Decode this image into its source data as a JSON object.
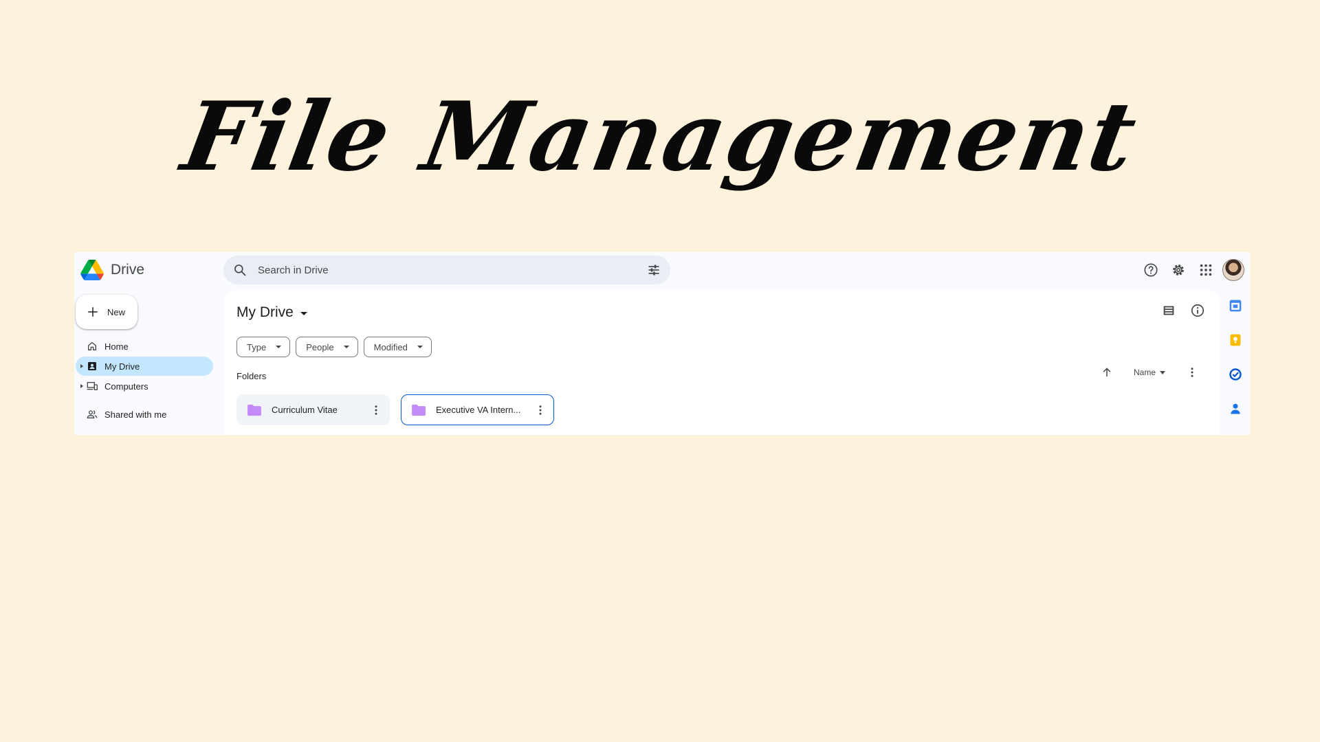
{
  "banner": {
    "title": "File Management"
  },
  "app": {
    "name": "Drive",
    "search_placeholder": "Search in Drive"
  },
  "sidebar": {
    "new_label": "New",
    "items": [
      {
        "label": "Home",
        "icon": "home-icon",
        "active": false
      },
      {
        "label": "My Drive",
        "icon": "my-drive-icon",
        "active": true
      },
      {
        "label": "Computers",
        "icon": "computers-icon",
        "active": false
      },
      {
        "label": "Shared with me",
        "icon": "shared-icon",
        "active": false
      }
    ]
  },
  "main": {
    "title": "My Drive",
    "filters": [
      "Type",
      "People",
      "Modified"
    ],
    "folders_label": "Folders",
    "sort_label": "Name",
    "folders": [
      {
        "name": "Curriculum Vitae",
        "selected": false
      },
      {
        "name": "Executive VA Intern...",
        "selected": true
      }
    ]
  },
  "colors": {
    "background": "#FFF2DC",
    "accent": "#0B57D0",
    "active_nav": "#C2E7FF",
    "folder_icon": "#C58AF9"
  }
}
